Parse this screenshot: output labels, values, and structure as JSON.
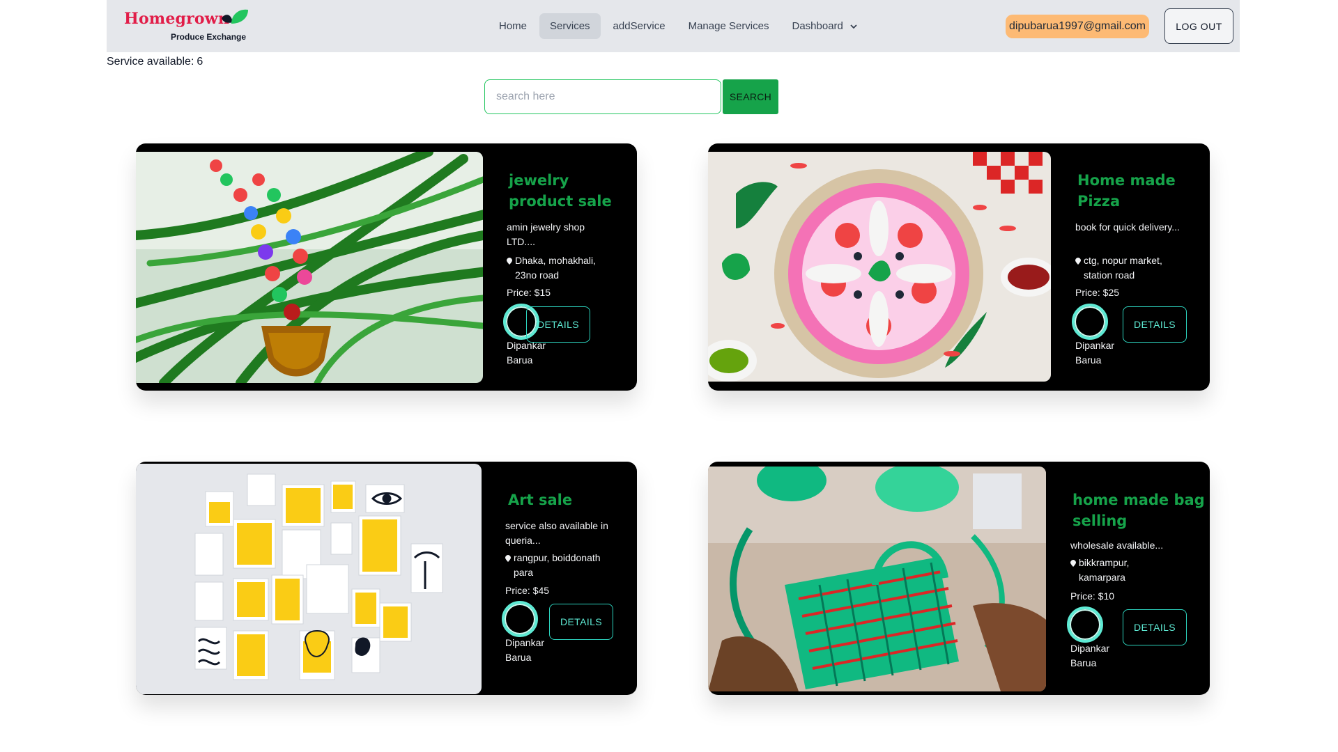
{
  "brand": {
    "name": "Homegrown",
    "tagline": "Produce Exchange"
  },
  "nav": {
    "links": [
      {
        "label": "Home"
      },
      {
        "label": "Services"
      },
      {
        "label": "addService"
      },
      {
        "label": "Manage Services"
      },
      {
        "label": "Dashboard"
      }
    ]
  },
  "user": {
    "email": "dipubarua1997@gmail.com",
    "logout_label": "LOG OUT"
  },
  "summary": {
    "label": "Service available:",
    "count": "6"
  },
  "search": {
    "placeholder": "search here",
    "button_label": "SEARCH"
  },
  "cards": [
    {
      "title": "jewelry product sale",
      "description": "amin jewelry shop LTD....",
      "location": "Dhaka, mohakhali, 23no road",
      "price": "Price: $15",
      "author": "Dipankar Barua",
      "details_label": "DETAILS",
      "image": "jewelry-necklace-on-palm-leaves"
    },
    {
      "title": "Home made Pizza",
      "description": "book for quick delivery...",
      "location": "ctg, nopur market, station road",
      "price": "Price: $25",
      "author": "Dipankar Barua",
      "details_label": "DETAILS",
      "image": "pizza-with-chillies"
    },
    {
      "title": "Art sale",
      "description": "service also available in queria...",
      "location": "rangpur, boiddonath para",
      "price": "Price: $45",
      "author": "Dipankar Barua",
      "details_label": "DETAILS",
      "image": "yellow-art-prints-on-wall"
    },
    {
      "title": "home made bag selling",
      "description": "wholesale available...",
      "location": "bikkrampur, kamarpara",
      "price": "Price: $10",
      "author": "Dipankar Barua",
      "details_label": "DETAILS",
      "image": "woven-green-bags"
    }
  ],
  "colors": {
    "accent_green": "#16a34a",
    "details_teal": "#2dd4bf",
    "email_pill": "#fdba74",
    "brand_red": "#e11d48"
  }
}
